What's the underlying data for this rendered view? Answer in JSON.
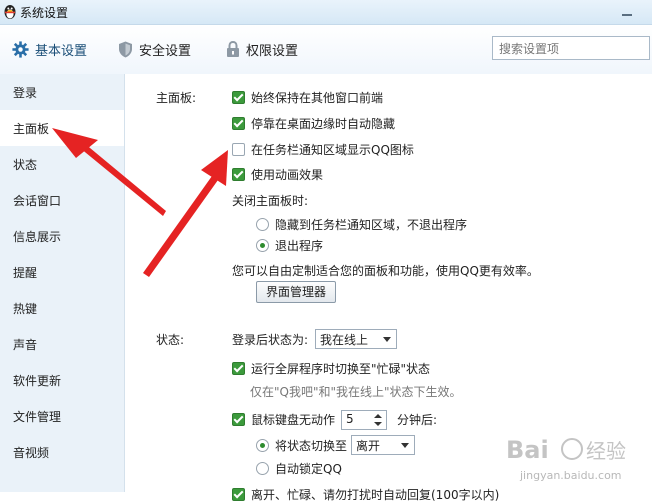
{
  "window": {
    "title": "系统设置",
    "icon": "qq-penguin-icon"
  },
  "topnav": {
    "tabs": [
      {
        "label": "基本设置",
        "icon": "gear-icon",
        "active": true
      },
      {
        "label": "安全设置",
        "icon": "shield-icon",
        "active": false
      },
      {
        "label": "权限设置",
        "icon": "lock-icon",
        "active": false
      }
    ],
    "search_placeholder": "搜索设置项"
  },
  "sidebar": {
    "items": [
      {
        "label": "登录"
      },
      {
        "label": "主面板",
        "selected": true
      },
      {
        "label": "状态"
      },
      {
        "label": "会话窗口"
      },
      {
        "label": "信息展示"
      },
      {
        "label": "提醒"
      },
      {
        "label": "热键"
      },
      {
        "label": "声音"
      },
      {
        "label": "软件更新"
      },
      {
        "label": "文件管理"
      },
      {
        "label": "音视频"
      }
    ]
  },
  "main_panel": {
    "section_label": "主面板:",
    "options": [
      {
        "label": "始终保持在其他窗口前端",
        "checked": true
      },
      {
        "label": "停靠在桌面边缘时自动隐藏",
        "checked": true
      },
      {
        "label": "在任务栏通知区域显示QQ图标",
        "checked": false
      },
      {
        "label": "使用动画效果",
        "checked": true
      }
    ],
    "close_label": "关闭主面板时:",
    "close_options": [
      {
        "label": "隐藏到任务栏通知区域，不退出程序",
        "selected": false
      },
      {
        "label": "退出程序",
        "selected": true
      }
    ],
    "customize_text": "您可以自由定制适合您的面板和功能，使用QQ更有效率。",
    "manager_button": "界面管理器"
  },
  "status": {
    "section_label": "状态:",
    "login_status_label": "登录后状态为:",
    "login_status_value": "我在线上",
    "fullscreen_option": {
      "label": "运行全屏程序时切换至\"忙碌\"状态",
      "checked": true
    },
    "fullscreen_hint": "仅在\"Q我吧\"和\"我在线上\"状态下生效。",
    "idle_option": {
      "label": "鼠标键盘无动作",
      "checked": true
    },
    "idle_minutes": "5",
    "idle_suffix": "分钟后:",
    "switch_status": {
      "label": "将状态切换至",
      "selected": true,
      "value": "离开"
    },
    "auto_lock": {
      "label": "自动锁定QQ",
      "selected": false
    },
    "partial_option_text": "离开、忙碌、请勿打扰时自动回复(100字以内)"
  },
  "watermark": {
    "text": "jingyan.baidu.com"
  },
  "colors": {
    "checkbox_green": "#3c9a3c",
    "arrow_red": "#e52323",
    "sidebar_bg": "#eaf2f9"
  }
}
